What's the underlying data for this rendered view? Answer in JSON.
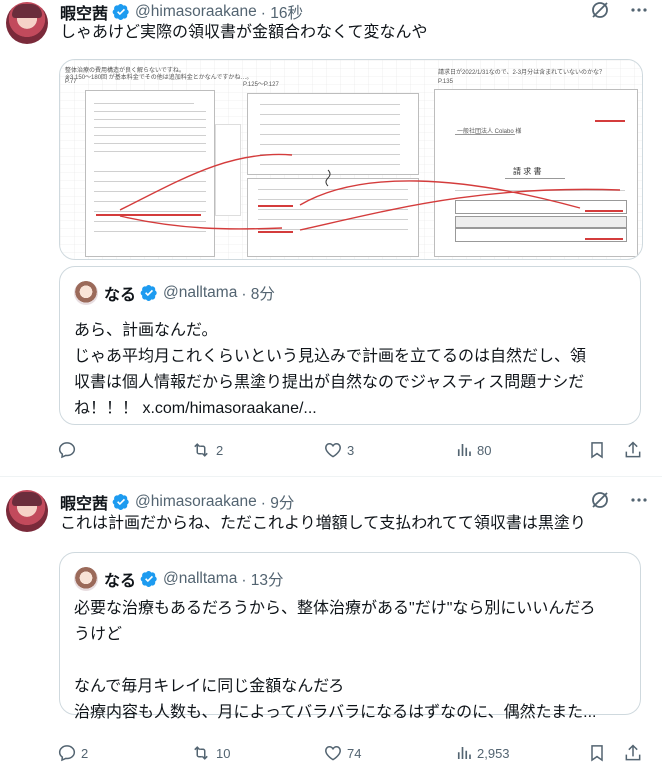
{
  "tweet1": {
    "display_name": "暇空茜",
    "handle": "@himasoraakane",
    "time": "· 16秒",
    "text": "しゃあけど実際の領収書が金額合わなくて変なんや",
    "media": {
      "caption_left1": "整体治療の費用構造が良く解らないですね。",
      "caption_left2": "※3,150～180回 が基本料金でその他は追加料金とかなんですかね…。",
      "page_left": "P.77",
      "page_mid": "P.125～P.127",
      "page_right": "P.135",
      "caption_right": "請求日が2022/1/31なので、2-3月分は含まれていないのかな？",
      "invoice_title": "請 求 書",
      "invoice_to": "一般社団法人 Colabo 様"
    },
    "quote": {
      "display_name": "なる",
      "handle": "@nalltama",
      "time": "· 8分",
      "text": "あら、計画なんだ。\nじゃあ平均月これくらいという見込みで計画を立てるのは自然だし、領\n収書は個人情報だから黒塗り提出が自然なのでジャスティス問題ナシだ\nね！！！ x.com/himasoraakane/..."
    },
    "actions": {
      "reply": "",
      "retweet": "2",
      "like": "3",
      "views": "80"
    }
  },
  "tweet2": {
    "display_name": "暇空茜",
    "handle": "@himasoraakane",
    "time": "· 9分",
    "text": "これは計画だからね、ただこれより増額して支払われてて領収書は黒塗り",
    "quote": {
      "display_name": "なる",
      "handle": "@nalltama",
      "time": "· 13分",
      "text": "必要な治療もあるだろうから、整体治療がある\"だけ\"なら別にいいんだろ\nうけど\n\nなんで毎月キレイに同じ金額なんだろ\n治療内容も人数も、月によってバラバラになるはずなのに、偶然たまた..."
    },
    "actions": {
      "reply": "2",
      "retweet": "10",
      "like": "74",
      "views": "2,953"
    }
  },
  "colors": {
    "accent": "#1d9bf0",
    "muted": "#536471",
    "border": "#cfd9de",
    "annot": "#d43c3c"
  }
}
